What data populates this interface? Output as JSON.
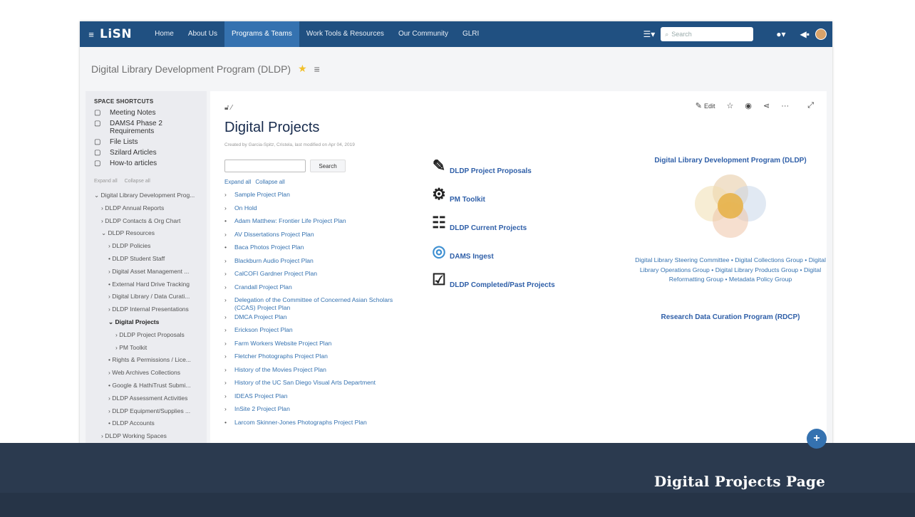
{
  "nav": {
    "logo": "LiSN",
    "items": [
      "Home",
      "About Us",
      "Programs & Teams",
      "Work Tools & Resources",
      "Our Community",
      "GLRI"
    ],
    "search_placeholder": "Search"
  },
  "space": {
    "title": "Digital Library Development Program (DLDP)"
  },
  "sidebar": {
    "section_title": "SPACE SHORTCUTS",
    "shortcuts": [
      "Meeting Notes",
      "DAMS4 Phase 2 Requirements",
      "File Lists",
      "Szilard Articles",
      "How-to articles"
    ],
    "expand_label": "Expand all",
    "collapse_label": "Collapse all",
    "tree": [
      "Digital Library Development Prog...",
      "DLDP Annual Reports",
      "DLDP Contacts & Org Chart",
      "DLDP Resources",
      "DLDP Policies",
      "DLDP Student Staff",
      "Digital Asset Management ...",
      "External Hard Drive Tracking",
      "Digital Library / Data Curati...",
      "DLDP Internal Presentations",
      "Digital Projects",
      "DLDP Project Proposals",
      "PM Toolkit",
      "Rights & Permissions / Lice...",
      "Web Archives Collections",
      "Google & HathiTrust Submi...",
      "DLDP Assessment Activities",
      "DLDP Equipment/Supplies ...",
      "DLDP Accounts",
      "DLDP Working Spaces"
    ]
  },
  "page": {
    "title": "Digital Projects",
    "byline": "Created by Garcia-Spitz, Cristela, last modified on Apr 04, 2019",
    "edit_label": "Edit",
    "search_button": "Search",
    "expand_all": "Expand all",
    "collapse_all": "Collapse all",
    "projects": [
      "Sample Project Plan",
      "On Hold",
      "Adam Matthew: Frontier Life Project Plan",
      "AV Dissertations Project Plan",
      "Baca Photos Project Plan",
      "Blackburn Audio Project Plan",
      "CalCOFI Gardner Project Plan",
      "Crandall Project Plan",
      "Delegation of the Committee of Concerned Asian Scholars (CCAS) Project Plan",
      "DMCA Project Plan",
      "Erickson Project Plan",
      "Farm Workers Website Project Plan",
      "Fletcher Photographs Project Plan",
      "History of the Movies Project Plan",
      "History of the UC San Diego Visual Arts Department",
      "IDEAS Project Plan",
      "InSite 2 Project Plan",
      "Larcom Skinner-Jones Photographs Project Plan"
    ],
    "quick_links": [
      {
        "label": "DLDP Project Proposals",
        "icon": "edit-icon"
      },
      {
        "label": "PM Toolkit",
        "icon": "gear-icon"
      },
      {
        "label": "DLDP Current Projects",
        "icon": "checklist-icon"
      },
      {
        "label": "DAMS Ingest",
        "icon": "ingest-icon"
      },
      {
        "label": "DLDP Completed/Past Projects",
        "icon": "clipboard-check-icon"
      }
    ],
    "right_heading": "Digital Library Development Program (DLDP)",
    "groups_text": "Digital Library Steering Committee • Digital Collections Group • Digital Library Operations Group • Digital Library Products Group • Digital Reformatting Group • Metadata Policy Group",
    "rdcp_heading": "Research Data Curation Program (RDCP)"
  },
  "slide": {
    "caption": "Digital Projects Page"
  },
  "colors": {
    "nav": "#205081",
    "nav_active": "#3572b0",
    "link": "#3572b0",
    "band": "#2b3a4f"
  }
}
